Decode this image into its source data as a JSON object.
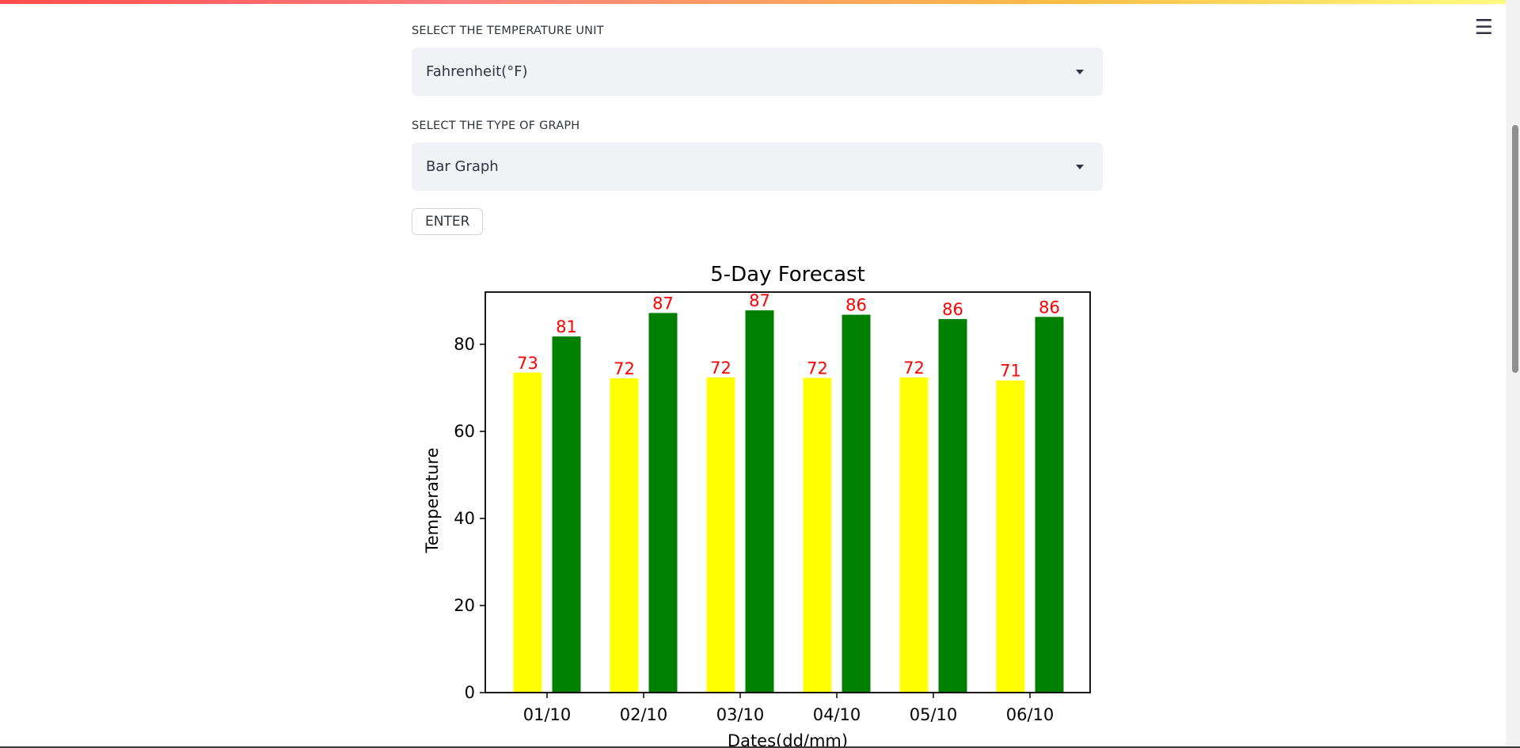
{
  "menu_icon": "hamburger-menu-icon",
  "temperature_unit": {
    "label": "SELECT THE TEMPERATURE UNIT",
    "selected": "Fahrenheit(°F)"
  },
  "graph_type": {
    "label": "SELECT THE TYPE OF GRAPH",
    "selected": "Bar Graph"
  },
  "enter_button": "ENTER",
  "colors": {
    "min": "#ffff00",
    "max": "#008000",
    "value_label": "#ff0000",
    "accent": "#ff4b4b"
  },
  "chart_data": {
    "type": "bar",
    "title": "5-Day Forecast",
    "xlabel": "Dates(dd/mm)",
    "ylabel": "Temperature",
    "categories": [
      "01/10",
      "02/10",
      "03/10",
      "04/10",
      "05/10",
      "06/10"
    ],
    "series": [
      {
        "values": [
          73.5,
          72.2,
          72.4,
          72.3,
          72.4,
          71.7
        ],
        "labels": [
          "73",
          "72",
          "72",
          "72",
          "72",
          "71"
        ],
        "color": "#ffff00"
      },
      {
        "values": [
          81.8,
          87.2,
          87.8,
          86.8,
          85.8,
          86.3
        ],
        "labels": [
          "81",
          "87",
          "87",
          "86",
          "86",
          "86"
        ],
        "color": "#008000"
      }
    ],
    "yticks": [
      0,
      20,
      40,
      60,
      80
    ],
    "ylim": [
      0,
      92
    ],
    "grid": false
  }
}
